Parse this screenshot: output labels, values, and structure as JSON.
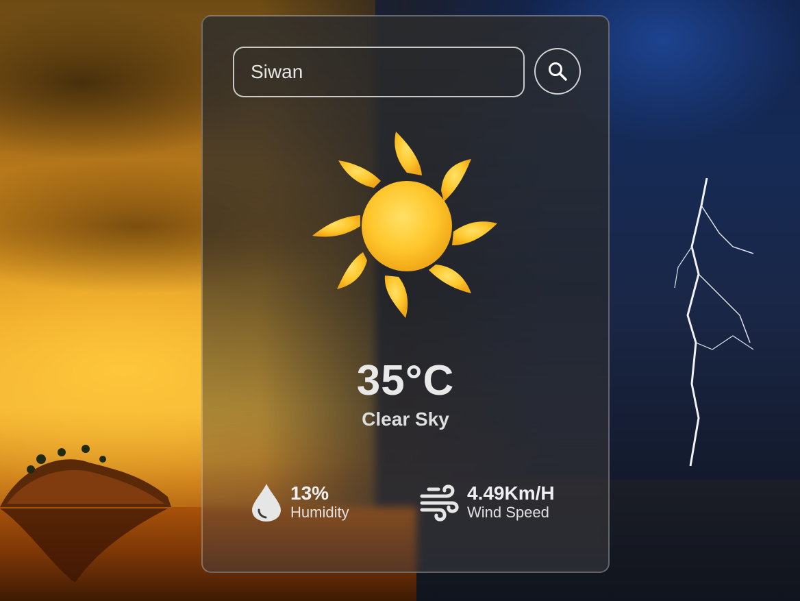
{
  "search": {
    "value": "Siwan"
  },
  "weather": {
    "temperature": "35°C",
    "condition": "Clear Sky",
    "icon": "sun-icon"
  },
  "stats": {
    "humidity": {
      "value": "13%",
      "label": "Humidity",
      "icon": "water-drop-icon"
    },
    "wind": {
      "value": "4.49Km/H",
      "label": "Wind Speed",
      "icon": "wind-icon"
    }
  },
  "colors": {
    "text": "#e9e9ea",
    "sun": "#ffc72c",
    "card_border": "#8a8a8a"
  }
}
